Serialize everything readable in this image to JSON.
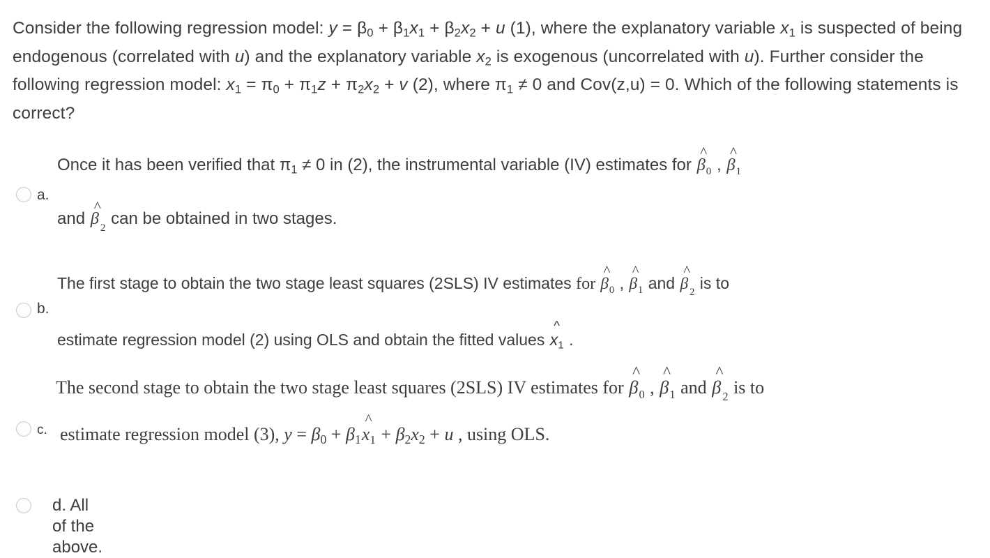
{
  "question": {
    "line1_a": "Consider the following regression model: ",
    "eq1_y": "y",
    "eq1_eq": " = ",
    "eq1_b0": "β",
    "eq1_b0sub": "0",
    "eq1_plus1": " + ",
    "eq1_b1": "β",
    "eq1_b1sub": "1",
    "eq1_x1": "x",
    "eq1_x1sub": "1",
    "eq1_plus2": " + ",
    "eq1_b2": "β",
    "eq1_b2sub": "2",
    "eq1_x2": "x",
    "eq1_x2sub": "2",
    "eq1_plus3": " + ",
    "eq1_u": "u",
    "eq1_num": " (1), where the explanatory variable ",
    "x1": "x",
    "x1sub": "1",
    "line2_mid": " is suspected of being endogenous (correlated with ",
    "u": "u",
    "line2_end": ") and the explanatory variable ",
    "x2": "x",
    "x2sub": "2",
    "line2_tail": " is exogenous (uncorrelated with ",
    "u2": "u",
    "line3_mid": "). Further consider the following regression model: ",
    "eq2_x1": "x",
    "eq2_x1sub": "1",
    "eq2_eq": " = ",
    "eq2_p0": "π",
    "eq2_p0sub": "0",
    "eq2_plus1": " + ",
    "eq2_p1": "π",
    "eq2_p1sub": "1",
    "eq2_z": "z",
    "eq2_plus2": " + ",
    "eq2_p2": "π",
    "eq2_p2sub": "2",
    "eq2_x2": "x",
    "eq2_x2sub": "2",
    "eq2_plus3": " + ",
    "eq2_v": "v",
    "eq2_num": " (2), where ",
    "pi1": "π",
    "pi1sub": "1",
    "line4_mid": " ≠ 0 and Cov(z,u) = 0. Which of the following statements is correct?"
  },
  "options": [
    {
      "letter": "a.",
      "radio_name": "radio-option-a",
      "text_line1_pre": "Once it has been verified that ",
      "pi": "π",
      "pisub": "1",
      "text_line1_mid": " ≠ 0 in (2), the instrumental variable (IV) estimates for ",
      "beta": "β",
      "b0": "0",
      "b1": "1",
      "b2": "2",
      "comma": " , ",
      "text_line2_pre": "and ",
      "text_line2_post": " can be obtained in two stages."
    },
    {
      "letter": "b.",
      "radio_name": "radio-option-b",
      "text_line1_pre": "The first stage to obtain the two stage least squares (2SLS) IV estimates ",
      "for_word": "for ",
      "beta": "β",
      "b0": "0",
      "b1": "1",
      "b2": "2",
      "comma": " , ",
      "and_word": " and ",
      "is_to": " is to",
      "text_line2_pre": "estimate regression model (2) using OLS and obtain the fitted values ",
      "xhat": "x",
      "xhatsub": "1",
      "text_line2_post": " ."
    },
    {
      "letter": "c.",
      "radio_name": "radio-option-c",
      "text_line1_pre": "The second stage to obtain the two stage least squares (2SLS) IV estimates for ",
      "beta": "β",
      "b0": "0",
      "b1": "1",
      "b2": "2",
      "comma": " , ",
      "and_word": " and ",
      "is_to": " is to",
      "text_line2_pre": "estimate regression model (3), ",
      "eq_y": "y",
      "eq_eq": " = ",
      "eq_b0": "β",
      "eq_b0sub": "0",
      "eq_plus1": " + ",
      "eq_b1": "β",
      "eq_b1sub": "1",
      "eq_xhat": "x",
      "eq_xhatsub": "1",
      "eq_plus2": " + ",
      "eq_b2": "β",
      "eq_b2sub": "2",
      "eq_x2": "x",
      "eq_x2sub": "2",
      "eq_plus3": " + ",
      "eq_u": "u",
      "text_line2_post": " , using OLS."
    },
    {
      "letter": "d.",
      "radio_name": "radio-option-d",
      "text": "All of the above."
    }
  ],
  "colors": {
    "text": "#3d3d3d",
    "background": "#ffffff",
    "radio_border": "#c9c9c9"
  }
}
